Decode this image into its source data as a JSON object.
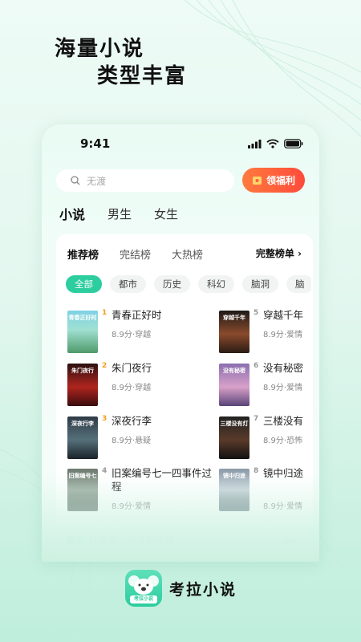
{
  "promo": {
    "line1": "海量小说",
    "line2": "类型丰富"
  },
  "status": {
    "time": "9:41"
  },
  "search": {
    "text": "无渡"
  },
  "welfare_label": "领福利",
  "top_tabs": [
    "小说",
    "男生",
    "女生"
  ],
  "rank_tabs": [
    "推荐榜",
    "完结榜",
    "大热榜"
  ],
  "full_list_label": "完整榜单 ›",
  "categories": [
    "全部",
    "都市",
    "历史",
    "科幻",
    "脑洞",
    "脑"
  ],
  "books": [
    {
      "rank": "1",
      "title": "青春正好时",
      "meta": "8.9分·穿越",
      "cover_title": "青春正好时"
    },
    {
      "rank": "2",
      "title": "朱门夜行",
      "meta": "8.9分·穿越",
      "cover_title": "朱门夜行"
    },
    {
      "rank": "3",
      "title": "深夜行李",
      "meta": "8.9分·悬疑",
      "cover_title": "深夜行李"
    },
    {
      "rank": "4",
      "title": "旧案编号七一四事件过程",
      "meta": "8.9分·爱情",
      "cover_title": "旧案编号七"
    },
    {
      "rank": "5",
      "title": "穿越千年",
      "meta": "8.9分·爱情",
      "cover_title": "穿越千年"
    },
    {
      "rank": "6",
      "title": "没有秘密",
      "meta": "8.9分·爱情",
      "cover_title": "没有秘密"
    },
    {
      "rank": "7",
      "title": "三楼没有",
      "meta": "8.9分·恐怖",
      "cover_title": "三楼没有灯"
    },
    {
      "rank": "8",
      "title": "镜中归途",
      "meta": "8.9分·爱情",
      "cover_title": "镜中归途"
    }
  ],
  "bottom_strip": {
    "tag": "原创",
    "text": "好故事，点开即值得",
    "more": "更多"
  },
  "brand": {
    "name": "考拉小说",
    "logo_label": "考拉小说"
  },
  "colors": {
    "accent": "#2ccd9f",
    "welfare": "#ff5a3c",
    "rank_top": "#f0a020",
    "rank": "#999999"
  }
}
